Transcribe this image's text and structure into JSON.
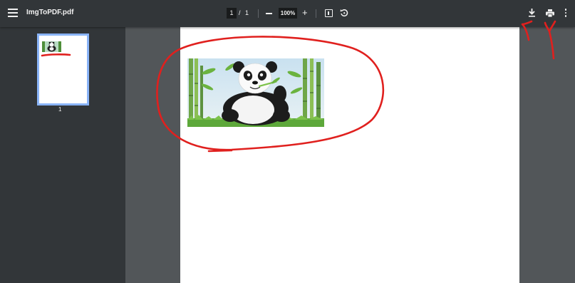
{
  "toolbar": {
    "title": "ImgToPDF.pdf",
    "current_page": "1",
    "page_separator": "/",
    "total_pages": "1",
    "zoom": "100%",
    "zoom_in_label": "+"
  },
  "sidebar": {
    "thumbnails": [
      {
        "page_label": "1"
      }
    ]
  },
  "document": {
    "image_subject": "panda-illustration"
  },
  "icons": {
    "menu": "hamburger-menu-icon",
    "zoom_out": "minus-icon",
    "fit": "fit-to-page-icon",
    "rotate": "rotate-counterclockwise-icon",
    "download": "download-icon",
    "print": "print-icon",
    "more": "more-vert-icon"
  },
  "colors": {
    "toolbar_bg": "#323639",
    "viewer_bg": "#525659",
    "thumbnail_border": "#8ab4f8",
    "annotation": "#e0201e"
  }
}
